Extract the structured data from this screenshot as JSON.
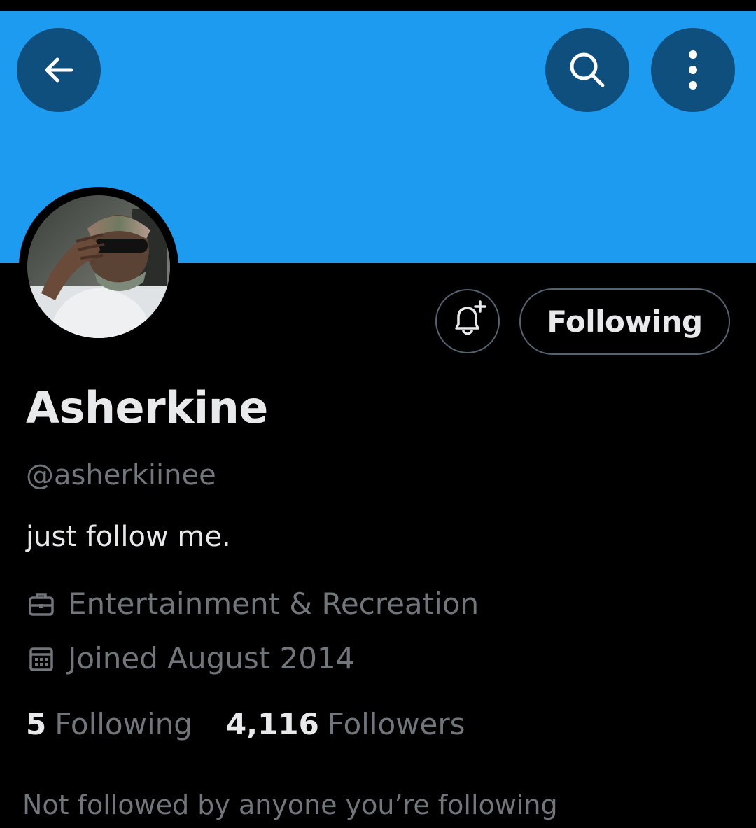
{
  "colors": {
    "banner": "#1d9bf0",
    "background": "#000000",
    "primary_text": "#e7e9ea",
    "secondary_text": "#71767b",
    "button_border": "#536471",
    "header_button": "#0f4f7e"
  },
  "header": {
    "back_icon": "arrow-left-icon",
    "search_icon": "search-icon",
    "more_icon": "more-vertical-icon"
  },
  "profile": {
    "display_name": "Asherkine",
    "handle": "@asherkiinee",
    "bio": "just follow me.",
    "category": "Entertainment & Recreation",
    "joined": "Joined August 2014",
    "following_count": "5",
    "following_label": "Following",
    "followers_count": "4,116",
    "followers_label": "Followers",
    "mutuals_note": "Not followed by anyone you’re following"
  },
  "actions": {
    "notify_icon": "bell-plus-icon",
    "follow_state_label": "Following"
  }
}
